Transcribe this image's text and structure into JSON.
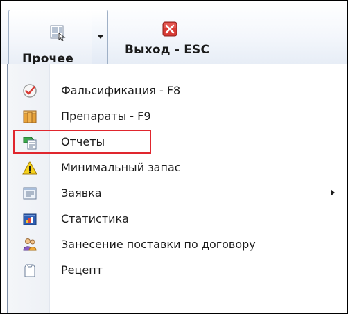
{
  "toolbar": {
    "other_label": "Прочее",
    "exit_label": "Выход - ESC",
    "other_icon": "toolbar-grid-icon",
    "exit_icon": "close-icon"
  },
  "menu": {
    "items": [
      {
        "label": "Фальсификация - F8",
        "icon": "check-badge-icon"
      },
      {
        "label": "Препараты - F9",
        "icon": "book-box-icon"
      },
      {
        "label": "Отчеты",
        "icon": "report-icon",
        "highlighted": true
      },
      {
        "label": "Минимальный запас",
        "icon": "warning-icon"
      },
      {
        "label": "Заявка",
        "icon": "document-icon",
        "has_submenu": true
      },
      {
        "label": "Статистика",
        "icon": "chart-icon"
      },
      {
        "label": "Занесение поставки по договору",
        "icon": "users-icon"
      },
      {
        "label": "Рецепт",
        "icon": "prescription-icon"
      }
    ]
  },
  "colors": {
    "highlight_border": "#e0262e",
    "exit_icon": "#d83b35"
  }
}
